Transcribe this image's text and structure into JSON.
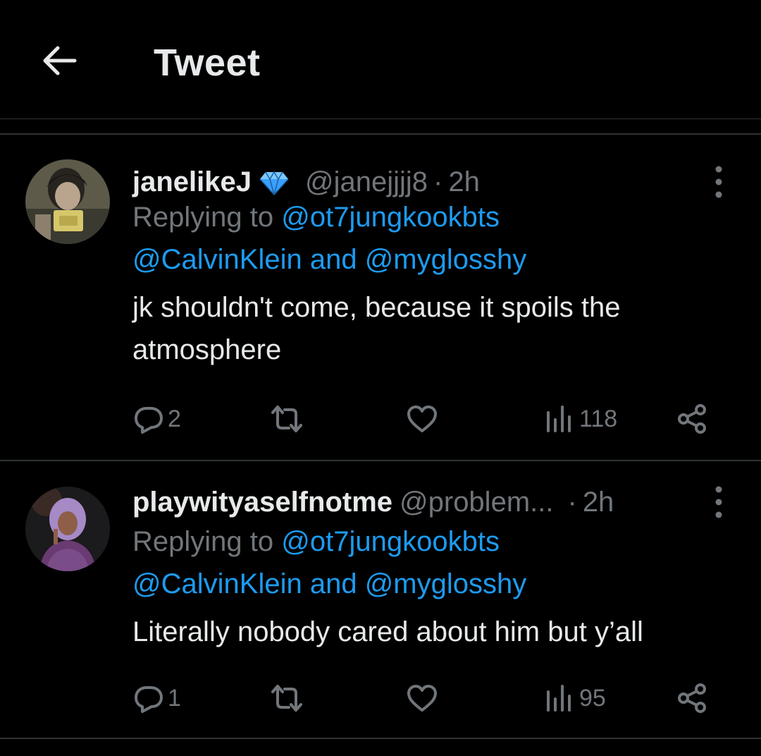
{
  "header": {
    "title": "Tweet"
  },
  "replies": [
    {
      "display_name": "janelikeJ",
      "handle": "@janejjjj8",
      "time": "2h",
      "replying_prefix": "Replying to",
      "mention1": "@ot7jungkookbts",
      "mention2": "@CalvinKlein",
      "and_word": "and",
      "mention3": "@myglosshy",
      "text_line1": "jk shouldn't come, because it spoils the",
      "text_line2": "atmosphere",
      "reply_count": "2",
      "views_count": "118"
    },
    {
      "display_name": "playwityaselfnotme",
      "handle": "@problem...",
      "time": "2h",
      "replying_prefix": "Replying to",
      "mention1": "@ot7jungkookbts",
      "mention2": "@CalvinKlein",
      "and_word": "and",
      "mention3": "@myglosshy",
      "text_line1": "Literally nobody cared about him but y’all",
      "reply_count": "1",
      "views_count": "95"
    }
  ]
}
